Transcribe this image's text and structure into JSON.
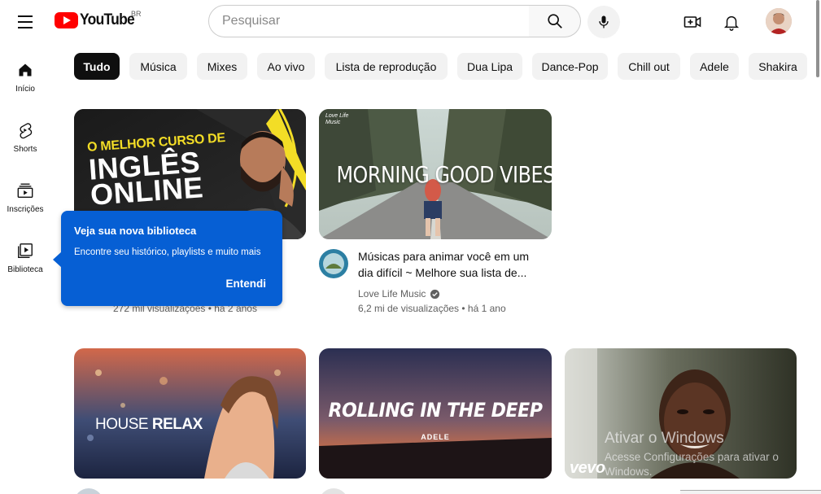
{
  "header": {
    "logo_text": "YouTube",
    "country_code": "BR",
    "search_placeholder": "Pesquisar",
    "icons": [
      "menu-icon",
      "search-icon",
      "mic-icon",
      "create-video-icon",
      "bell-icon"
    ]
  },
  "sidebar": {
    "items": [
      {
        "label": "Início",
        "icon": "home-icon"
      },
      {
        "label": "Shorts",
        "icon": "shorts-icon"
      },
      {
        "label": "Inscrições",
        "icon": "subscriptions-icon"
      },
      {
        "label": "Biblioteca",
        "icon": "library-icon"
      }
    ]
  },
  "chips": [
    "Tudo",
    "Música",
    "Mixes",
    "Ao vivo",
    "Lista de reprodução",
    "Dua Lipa",
    "Dance-Pop",
    "Chill out",
    "Adele",
    "Shakira"
  ],
  "videos": [
    {
      "thumb_text_1": "O MELHOR CURSO DE",
      "thumb_text_2": "INGLÊS",
      "thumb_text_3": "ONLINE",
      "stats": "272 mil visualizações • há 2 anos"
    },
    {
      "thumb_brand": "Love Life Music",
      "thumb_text": "MORNING GOOD VIBES",
      "title_line1": "Músicas para animar você em um",
      "title_line2": "dia difícil ~ Melhore sua lista de...",
      "channel": "Love Life Music",
      "stats": "6,2 mi de visualizações • há 1 ano"
    },
    {
      "thumb_text_1": "HOUSE",
      "thumb_text_2": "RELAX"
    },
    {
      "thumb_text": "ROLLING IN THE DEEP",
      "thumb_sub": "ADELE"
    },
    {
      "thumb_logo": "vevo"
    }
  ],
  "tooltip": {
    "title": "Veja sua nova biblioteca",
    "text": "Encontre seu histórico, playlists e muito mais",
    "button": "Entendi"
  },
  "watermark": {
    "title": "Ativar o Windows",
    "text": "Acesse Configurações para ativar o Windows."
  }
}
